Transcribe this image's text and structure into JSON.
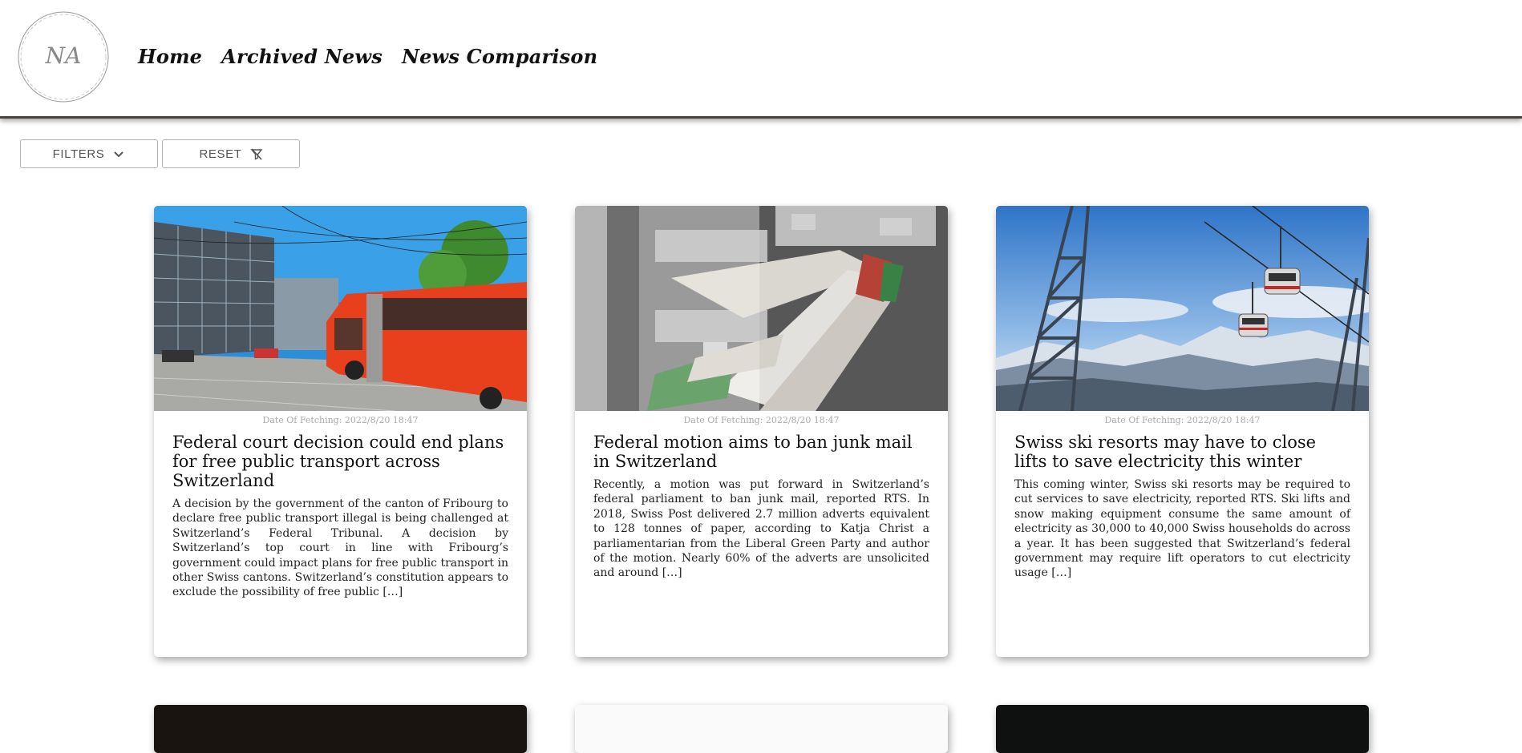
{
  "logo": {
    "initials": "NA"
  },
  "nav": {
    "home": "Home",
    "archived": "Archived News",
    "comparison": "News Comparison"
  },
  "toolbar": {
    "filters_label": "FILTERS",
    "reset_label": "RESET"
  },
  "articles": [
    {
      "date": "Date Of Fetching: 2022/8/20 18:47",
      "title": "Federal court decision could end plans for free public transport across Switzerland",
      "description": "A decision by the government of the canton of Fribourg to declare free public transport illegal is being challenged at Switzerland’s Federal Tribunal. A decision by Switzerland’s top court in line with Fribourg’s government could impact plans for free public transport in other Swiss cantons. Switzerland’s constitution appears to exclude the possibility of free public […]",
      "image": "red-articulated-bus-in-city"
    },
    {
      "date": "Date Of Fetching: 2022/8/20 18:47",
      "title": "Federal motion aims to ban junk mail in Switzerland",
      "description": "Recently, a motion was put forward in Switzerland’s federal parliament to ban junk mail, reported RTS. In 2018, Swiss Post delivered 2.7 million adverts equivalent to 128 tonnes of paper, according to Katja Christ a parliamentarian from the Liberal Green Party and author of the motion. Nearly 60% of the adverts are unsolicited and around […]",
      "image": "mailboxes-stuffed-with-flyers"
    },
    {
      "date": "Date Of Fetching: 2022/8/20 18:47",
      "title": "Swiss ski resorts may have to close lifts to save electricity this winter",
      "description": "This coming winter, Swiss ski resorts may be required to cut services to save electricity, reported RTS. Ski lifts and snow making equipment consume the same amount of electricity as 30,000 to 40,000 Swiss households do across a year. It has been suggested that Switzerland’s federal government may require lift operators to cut electricity usage […]",
      "image": "cable-car-gondolas-over-mountains"
    }
  ]
}
